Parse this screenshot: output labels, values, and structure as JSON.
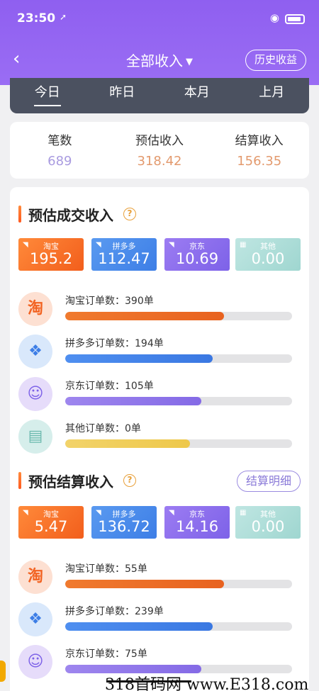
{
  "status_bar": {
    "time": "23:50",
    "location_arrow": "➚",
    "wifi_icon": "wifi-icon",
    "battery_icon": "battery-icon"
  },
  "nav": {
    "back_icon": "‹",
    "title": "全部收入",
    "caret": "▼",
    "history_button": "历史收益"
  },
  "tabs": [
    "今日",
    "昨日",
    "本月",
    "上月"
  ],
  "active_tab": 0,
  "summary": [
    {
      "label": "笔数",
      "value": "689",
      "color": "#a99be0"
    },
    {
      "label": "预估收入",
      "value": "318.42",
      "color": "#e39a6e"
    },
    {
      "label": "结算收入",
      "value": "156.35",
      "color": "#e39a6e"
    }
  ],
  "estimated_section": {
    "title": "预估成交收入",
    "help": "?",
    "platforms": [
      {
        "name": "淘宝",
        "value": "195.2"
      },
      {
        "name": "拼多多",
        "value": "112.47"
      },
      {
        "name": "京东",
        "value": "10.69"
      },
      {
        "name": "其他",
        "value": "0.00"
      }
    ],
    "orders": [
      {
        "label": "淘宝订单数：390单",
        "icon": "淘",
        "progress": 0.7
      },
      {
        "label": "拼多多订单数：194单",
        "icon": "❖",
        "progress": 0.65
      },
      {
        "label": "京东订单数：105单",
        "icon": "☺",
        "progress": 0.6
      },
      {
        "label": "其他订单数：0单",
        "icon": "▤",
        "progress": 0.55
      }
    ]
  },
  "settlement_section": {
    "title": "预估结算收入",
    "help": "?",
    "detail_button": "结算明细",
    "platforms": [
      {
        "name": "淘宝",
        "value": "5.47"
      },
      {
        "name": "拼多多",
        "value": "136.72"
      },
      {
        "name": "京东",
        "value": "14.16"
      },
      {
        "name": "其他",
        "value": "0.00"
      }
    ],
    "orders": [
      {
        "label": "淘宝订单数：55单",
        "icon": "淘",
        "progress": 0.7
      },
      {
        "label": "拼多多订单数：239单",
        "icon": "❖",
        "progress": 0.65
      },
      {
        "label": "京东订单数：75单",
        "icon": "☺",
        "progress": 0.6
      }
    ]
  },
  "watermark": "318首码网 www.E318.com"
}
